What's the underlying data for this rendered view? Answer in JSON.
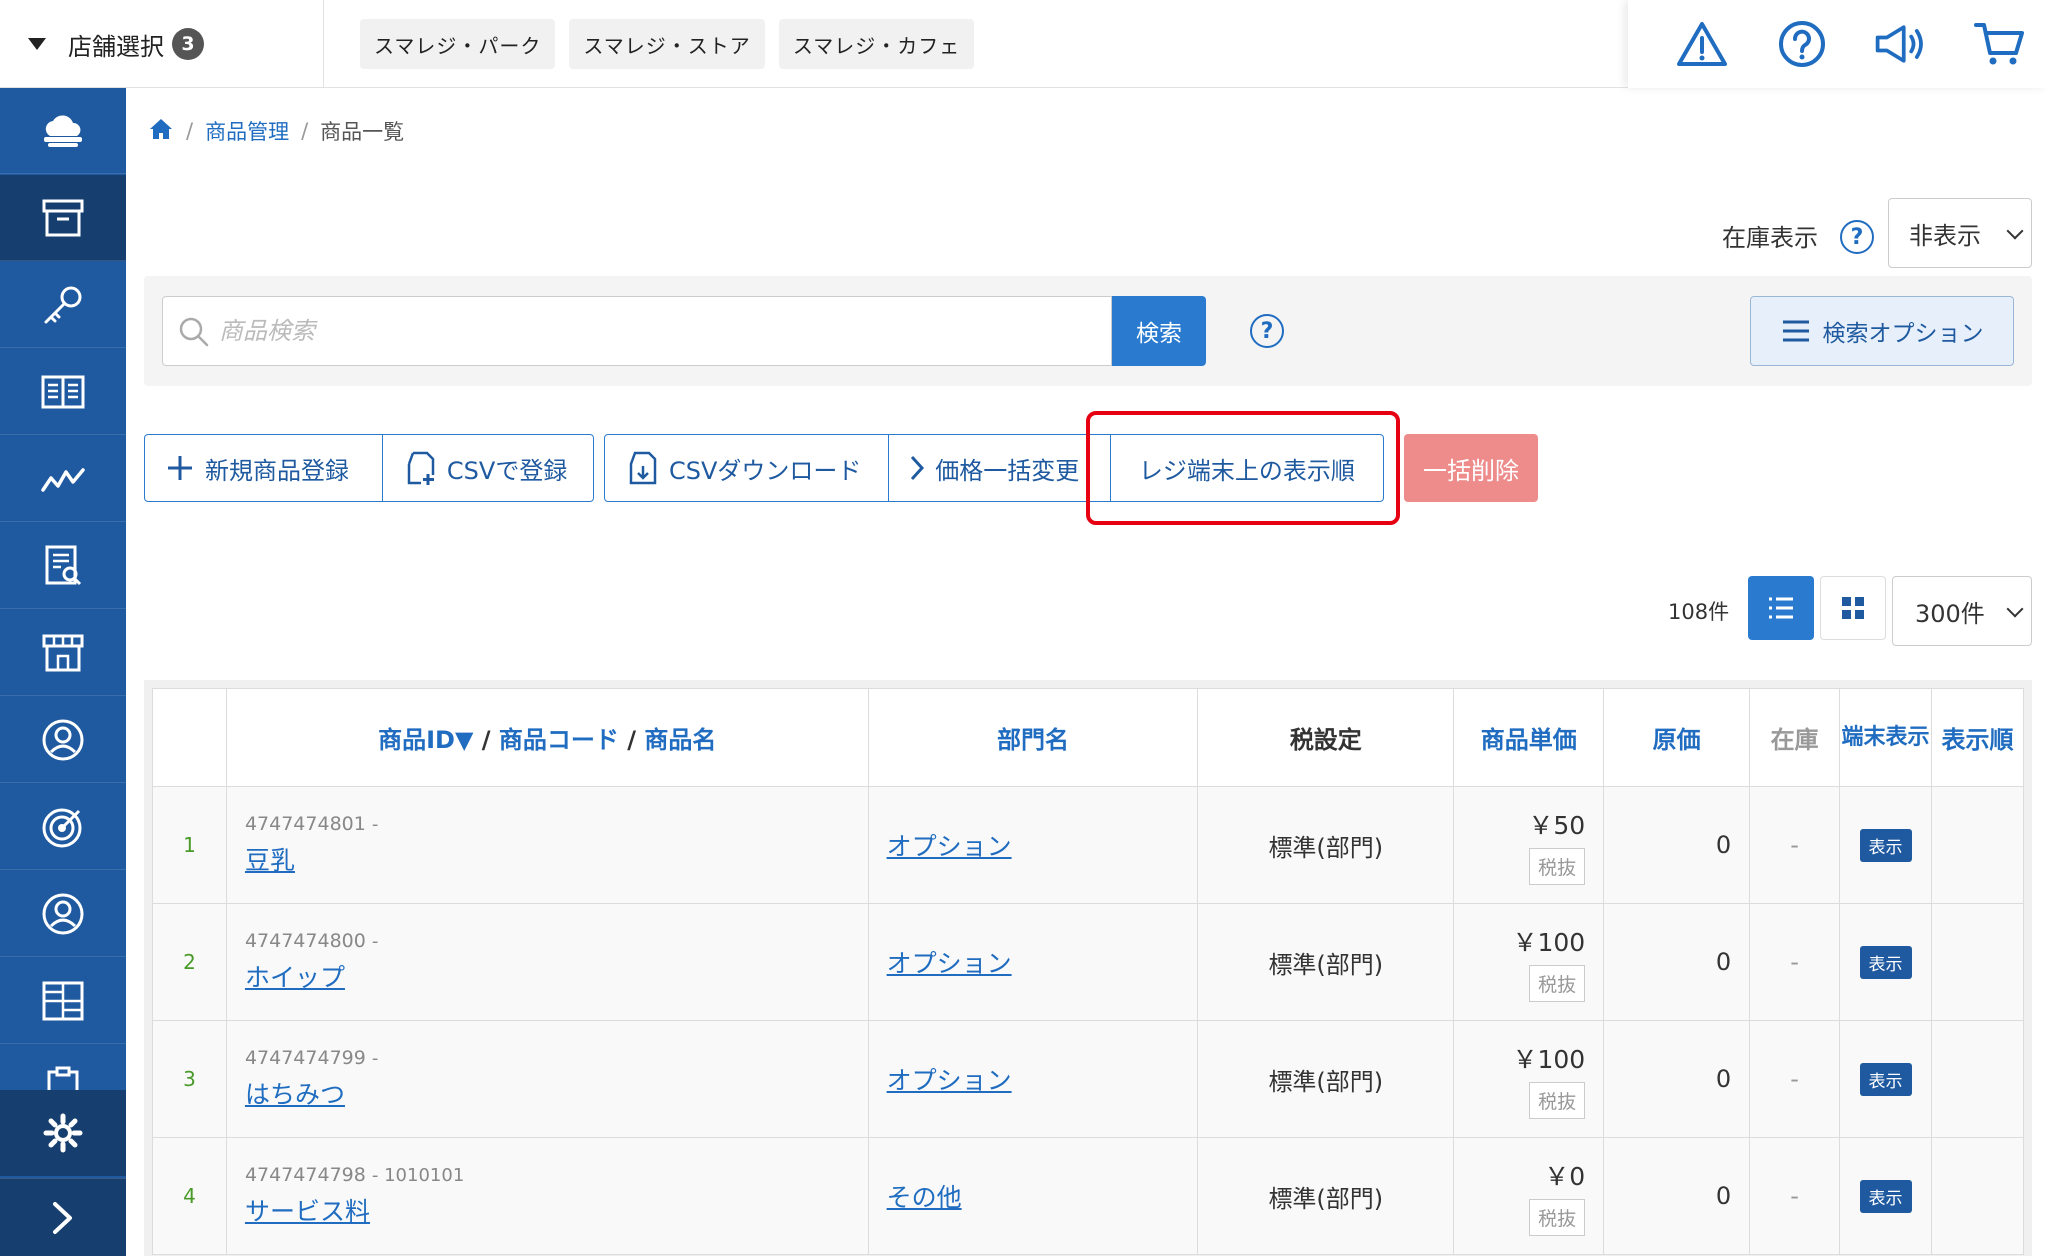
{
  "topbar": {
    "store_select_label": "店舗選択",
    "store_count": "3",
    "stores": [
      "スマレジ・パーク",
      "スマレジ・ストア",
      "スマレジ・カフェ"
    ],
    "icons": [
      "warning-icon",
      "help-icon",
      "megaphone-icon",
      "cart-icon"
    ]
  },
  "sidebar": {
    "items": [
      "cloud-icon",
      "box-icon",
      "key-icon",
      "book-icon",
      "chart-icon",
      "report-icon",
      "store-icon",
      "user-icon",
      "target-icon",
      "customer-icon",
      "grid-icon",
      "clipboard-icon"
    ],
    "active": "box-icon",
    "bottom": [
      "gear-icon",
      "chevron-right-icon"
    ]
  },
  "breadcrumb": {
    "home_icon": "home-icon",
    "level1": "商品管理",
    "level2": "商品一覧"
  },
  "stock_display": {
    "label": "在庫表示",
    "value": "非表示"
  },
  "search": {
    "placeholder": "商品検索",
    "button": "検索",
    "options_button": "検索オプション"
  },
  "actions": {
    "new_product": "新規商品登録",
    "csv_register": "CSVで登録",
    "csv_download": "CSVダウンロード",
    "bulk_price": "価格一括変更",
    "display_order": "レジ端末上の表示順",
    "bulk_delete": "一括削除"
  },
  "list": {
    "count": "108件",
    "per_page": "300件"
  },
  "table": {
    "headers": {
      "id_code_name_1": "商品ID▼",
      "sep1": " / ",
      "id_code_name_2": "商品コード",
      "sep2": " / ",
      "id_code_name_3": "商品名",
      "department": "部門名",
      "tax": "税設定",
      "price": "商品単価",
      "cost": "原価",
      "stock": "在庫",
      "terminal_display": "端末表示",
      "display_order": "表示順"
    },
    "rows": [
      {
        "no": "1",
        "id": "4747474801",
        "code": "-",
        "name": "豆乳",
        "dept": "オプション",
        "tax": "標準(部門)",
        "price": "￥50",
        "price_tag": "税抜",
        "cost": "0",
        "stock": "-",
        "display": "表示"
      },
      {
        "no": "2",
        "id": "4747474800",
        "code": "-",
        "name": "ホイップ",
        "dept": "オプション",
        "tax": "標準(部門)",
        "price": "￥100",
        "price_tag": "税抜",
        "cost": "0",
        "stock": "-",
        "display": "表示"
      },
      {
        "no": "3",
        "id": "4747474799",
        "code": "-",
        "name": "はちみつ",
        "dept": "オプション",
        "tax": "標準(部門)",
        "price": "￥100",
        "price_tag": "税抜",
        "cost": "0",
        "stock": "-",
        "display": "表示"
      },
      {
        "no": "4",
        "id": "4747474798",
        "code": "- 1010101",
        "name": "サービス料",
        "dept": "その他",
        "tax": "標準(部門)",
        "price": "￥0",
        "price_tag": "税抜",
        "cost": "0",
        "stock": "-",
        "display": "表示"
      }
    ]
  },
  "colors": {
    "primary": "#2a7bd0",
    "sidebar": "#1f5aa0",
    "highlight": "#e60012",
    "danger_disabled": "#ee8c8c"
  }
}
